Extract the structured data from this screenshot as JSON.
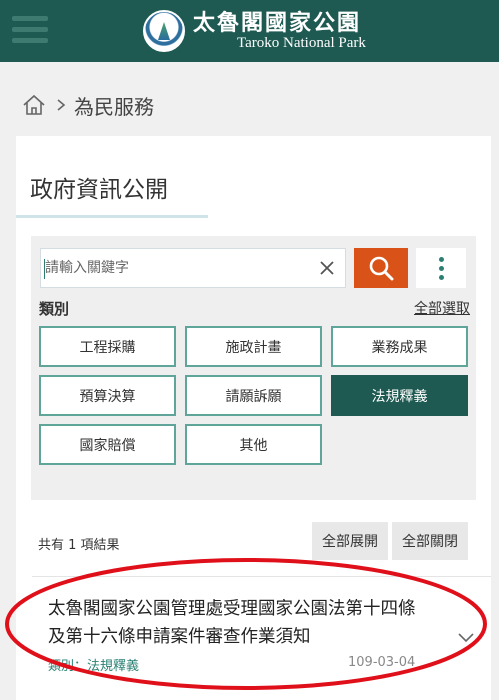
{
  "header": {
    "title": "太魯閣國家公園",
    "subtitle": "Taroko National Park",
    "menu_icon": "hamburger-menu-icon",
    "brand_color": "#1e5a52"
  },
  "breadcrumb": {
    "home_icon": "home-icon",
    "current": "為民服務"
  },
  "main": {
    "title": "政府資訊公開"
  },
  "search": {
    "placeholder": "請輸入關鍵字",
    "value": "",
    "clear_icon": "close-icon",
    "search_icon": "search-icon",
    "more_icon": "more-vertical-icon",
    "accent_color": "#d95319"
  },
  "categories": {
    "label": "類別",
    "select_all": "全部選取",
    "items": [
      {
        "label": "工程採購",
        "active": false
      },
      {
        "label": "施政計畫",
        "active": false
      },
      {
        "label": "業務成果",
        "active": false
      },
      {
        "label": "預算決算",
        "active": false
      },
      {
        "label": "請願訴願",
        "active": false
      },
      {
        "label": "法規釋義",
        "active": true
      },
      {
        "label": "國家賠償",
        "active": false
      },
      {
        "label": "其他",
        "active": false
      }
    ]
  },
  "results": {
    "count_text": "共有 1 項結果",
    "expand_all": "全部展開",
    "collapse_all": "全部關閉",
    "items": [
      {
        "title": "太魯閣國家公園管理處受理國家公園法第十四條及第十六條申請案件審查作業須知",
        "category": "類別：法規釋義",
        "date": "109-03-04"
      }
    ]
  },
  "annotation_color": "#e0101a"
}
